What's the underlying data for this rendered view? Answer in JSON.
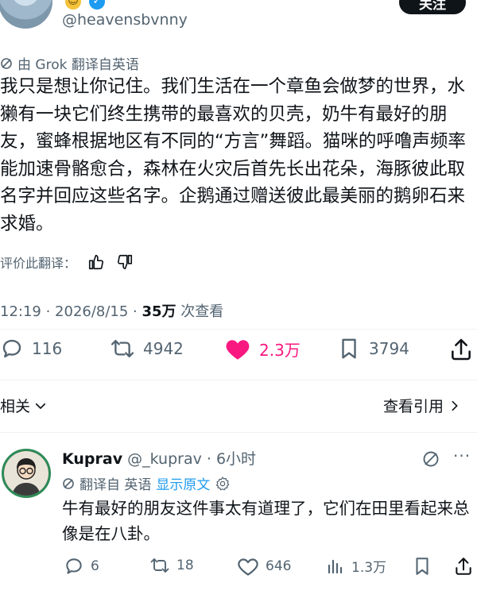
{
  "header": {
    "handle": "@heavensbvnny",
    "follow_label": "关注"
  },
  "post": {
    "translated_note": "由 Grok 翻译自英语",
    "body": "我只是想让你记住。我们生活在一个章鱼会做梦的世界，水獭有一块它们终生携带的最喜欢的贝壳，奶牛有最好的朋友，蜜蜂根据地区有不同的“方言”舞蹈。猫咪的呼噜声频率能加速骨骼愈合，森林在火灾后首先长出花朵，海豚彼此取名字并回应这些名字。企鹅通过赠送彼此最美丽的鹅卵石来求婚。",
    "rate_label": "评价此翻译：",
    "time": "12:19 · 2026/8/15 · ",
    "views_count": "35万",
    "views_label": " 次查看",
    "stats": {
      "replies": "116",
      "reposts": "4942",
      "likes": "2.3万",
      "bookmarks": "3794"
    }
  },
  "related": {
    "label": "相关",
    "view_quotes": "查看引用"
  },
  "reply": {
    "name": "Kuprav",
    "handle_time": " @_kuprav · 6小时",
    "translate_label": "翻译自 英语",
    "show_original": "显示原文",
    "body": "牛有最好的朋友这件事太有道理了，它们在田里看起来总像是在八卦。",
    "stats": {
      "replies": "6",
      "reposts": "18",
      "likes": "646",
      "views": "1.3万"
    }
  },
  "colors": {
    "like_pink": "#f91880",
    "link_blue": "#1d9bf0",
    "muted": "#536471"
  }
}
